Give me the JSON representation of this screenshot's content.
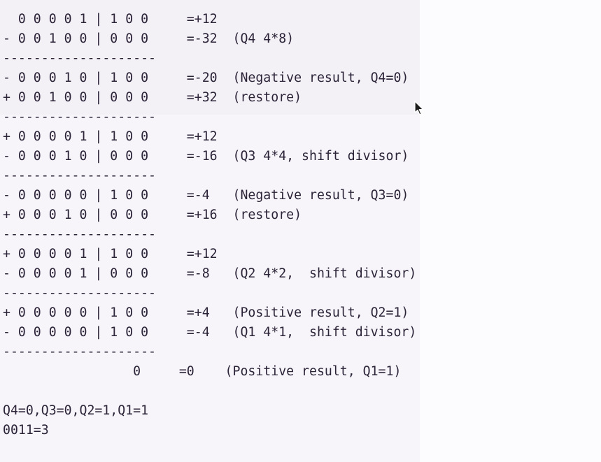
{
  "lines": [
    "  0 0 0 0 1 | 1 0 0     =+12",
    "- 0 0 1 0 0 | 0 0 0     =-32  (Q4 4*8)",
    "--------------------",
    "- 0 0 0 1 0 | 1 0 0     =-20  (Negative result, Q4=0)",
    "+ 0 0 1 0 0 | 0 0 0     =+32  (restore)",
    "--------------------",
    "+ 0 0 0 0 1 | 1 0 0     =+12",
    "- 0 0 0 1 0 | 0 0 0     =-16  (Q3 4*4, shift divisor)",
    "--------------------",
    "- 0 0 0 0 0 | 1 0 0     =-4   (Negative result, Q3=0)",
    "+ 0 0 0 1 0 | 0 0 0     =+16  (restore)",
    "--------------------",
    "+ 0 0 0 0 1 | 1 0 0     =+12",
    "- 0 0 0 0 1 | 0 0 0     =-8   (Q2 4*2,  shift divisor)",
    "--------------------",
    "+ 0 0 0 0 0 | 1 0 0     =+4   (Positive result, Q2=1)",
    "- 0 0 0 0 0 | 1 0 0     =-4   (Q1 4*1,  shift divisor)",
    "--------------------",
    "                 0     =0    (Positive result, Q1=1)",
    "",
    "Q4=0,Q3=0,Q2=1,Q1=1",
    "0011=3"
  ],
  "colors": {
    "text": "#2b2338",
    "background": "#f7f5f9"
  },
  "cursor_icon": "mouse-pointer-icon"
}
